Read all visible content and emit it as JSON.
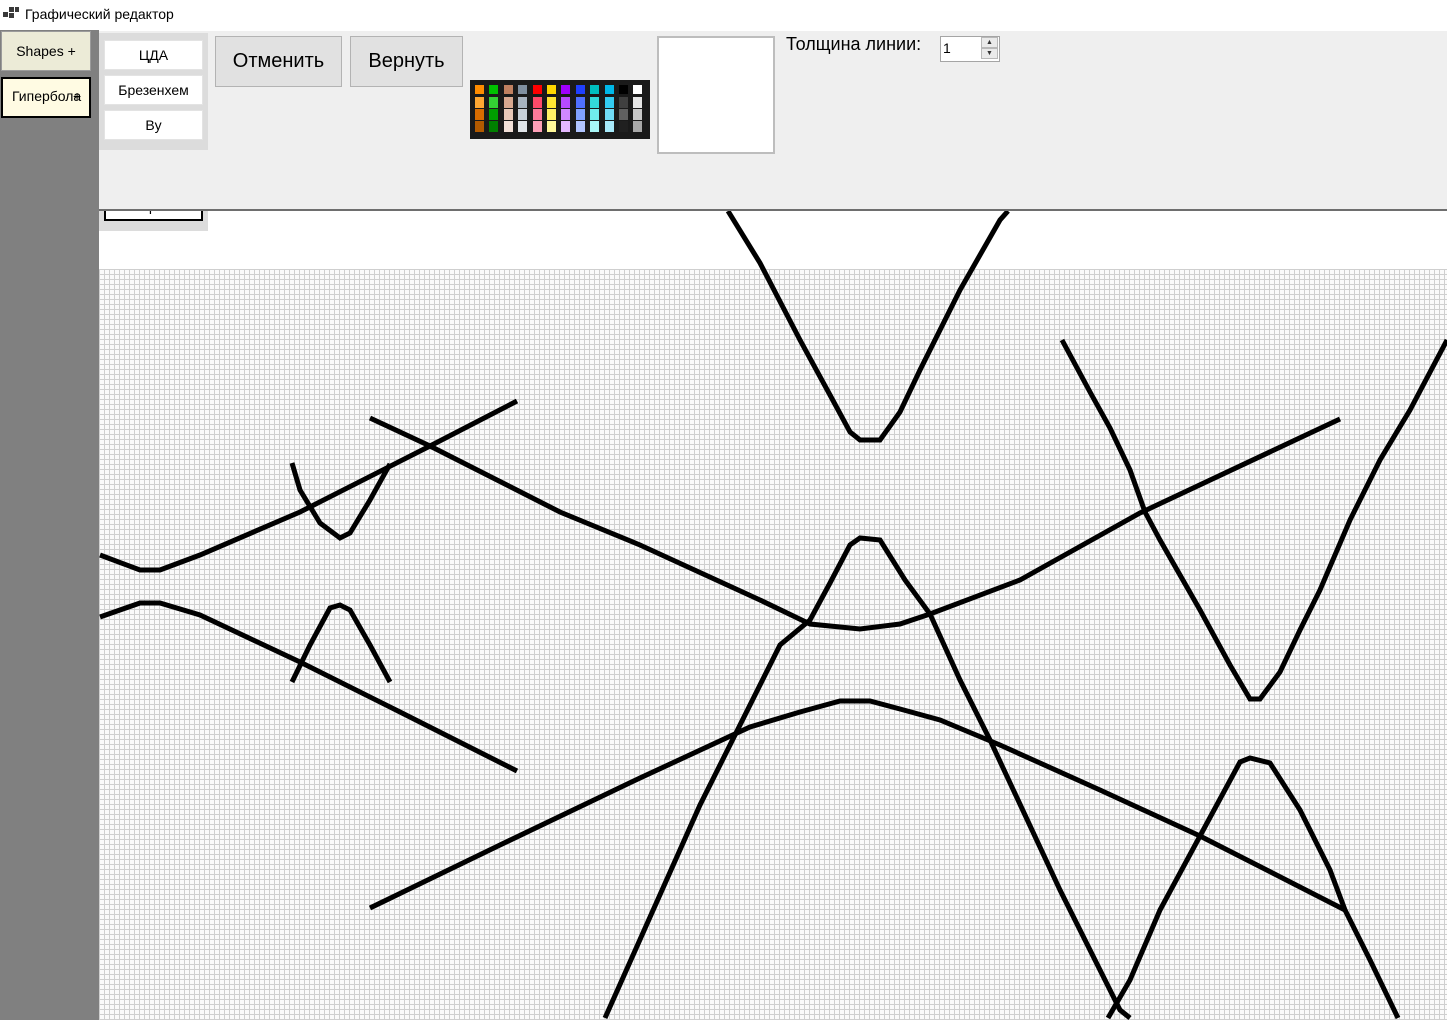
{
  "window": {
    "title": "Графический редактор",
    "icon": "app-window-icon"
  },
  "sidebar": {
    "shapes_label": "Shapes",
    "shapes_plus": "+",
    "hyperbola_label": "Гипербола",
    "hyperbola_plus": "+"
  },
  "algorithms": {
    "cda": "ЦДА",
    "bresenham": "Брезенхем",
    "wu": "Ву"
  },
  "toolbar": {
    "undo_label": "Отменить",
    "redo_label": "Вернуть"
  },
  "palette": {
    "colors": [
      [
        "#ff8c00",
        "#ffa733",
        "#d86c00",
        "#b35a00"
      ],
      [
        "#00c000",
        "#34d134",
        "#009e00",
        "#007f00"
      ],
      [
        "#c08060",
        "#d8a890",
        "#e8c8b8",
        "#f2e0d8"
      ],
      [
        "#8090a0",
        "#a8b4c0",
        "#c8d0d8",
        "#e0e4e8"
      ],
      [
        "#ff0000",
        "#ff4a6a",
        "#ff7a9a",
        "#ffa0b8"
      ],
      [
        "#ffd800",
        "#ffe633",
        "#fff066",
        "#fff899"
      ],
      [
        "#a000ff",
        "#b84aff",
        "#d088ff",
        "#e4b8ff"
      ],
      [
        "#2040ff",
        "#5070ff",
        "#80a0ff",
        "#b0c4ff"
      ],
      [
        "#00c0c0",
        "#33dada",
        "#70ecec",
        "#a8f6f6"
      ],
      [
        "#00b8e8",
        "#33ccf2",
        "#70dcf6",
        "#a8eafa"
      ],
      [
        "#000000",
        "#404040",
        "#606060",
        "#202020"
      ],
      [
        "#ffffff",
        "#e6e6e6",
        "#c8c8c8",
        "#a8a8a8"
      ]
    ]
  },
  "color_preview": {
    "color": "#ffffff"
  },
  "thickness": {
    "label": "Толщина линии:",
    "value": "1"
  },
  "canvas": {
    "stroke_color": "#000000",
    "grid_color": "#cfcfcf",
    "hidden_button_label": "Гипербола"
  }
}
